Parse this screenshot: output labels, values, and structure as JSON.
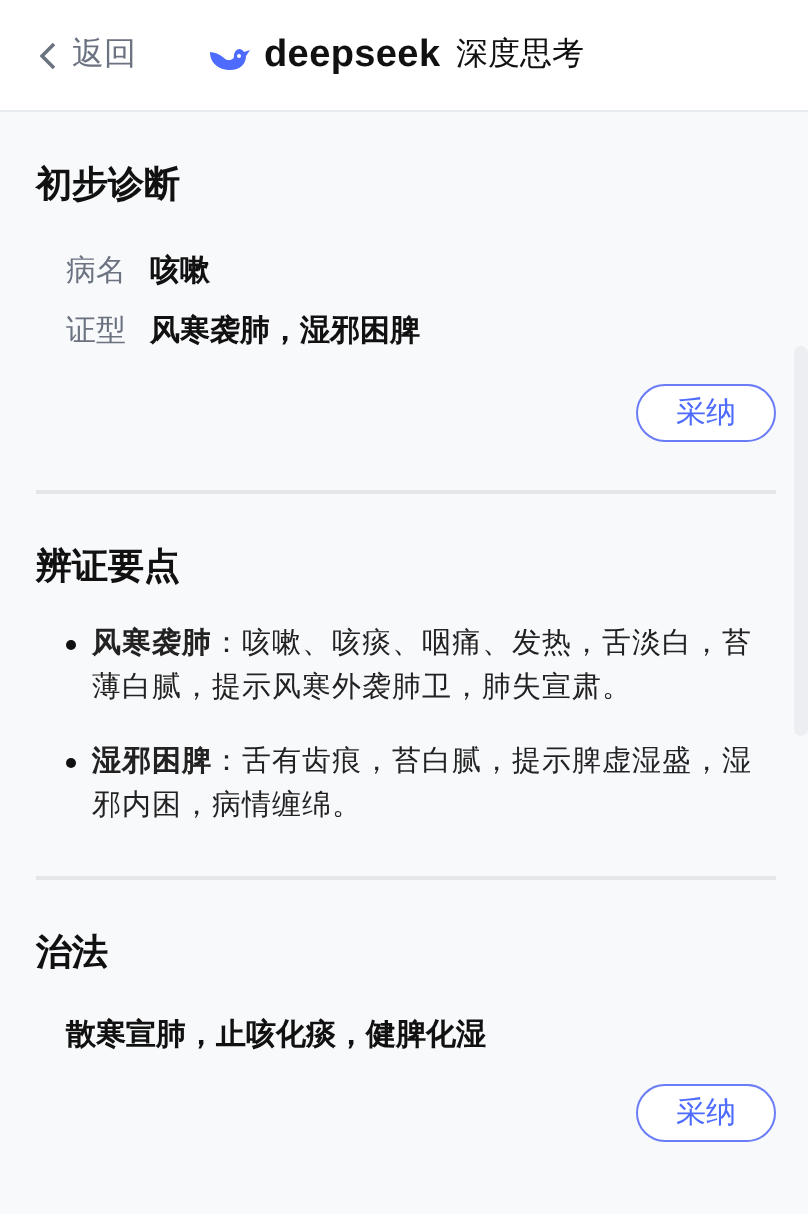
{
  "header": {
    "back": "返回",
    "brand": "deepseek",
    "mode": "深度思考"
  },
  "sections": [
    {
      "kind": "fields",
      "title": "初步诊断",
      "fields": [
        {
          "label": "病名",
          "value": "咳嗽"
        },
        {
          "label": "证型",
          "value": "风寒袭肺，湿邪困脾"
        }
      ],
      "action": "采纳"
    },
    {
      "kind": "bullets",
      "title": "辨证要点",
      "items": [
        "**风寒袭肺**：咳嗽、咳痰、咽痛、发热，舌淡白，苔薄白腻，提示风寒外袭肺卫，肺失宣肃。",
        "**湿邪困脾**：舌有齿痕，苔白腻，提示脾虚湿盛，湿邪内困，病情缠绵。"
      ]
    },
    {
      "kind": "text",
      "title": "治法",
      "text": "散寒宣肺，止咳化痰，健脾化湿",
      "action": "采纳"
    }
  ]
}
